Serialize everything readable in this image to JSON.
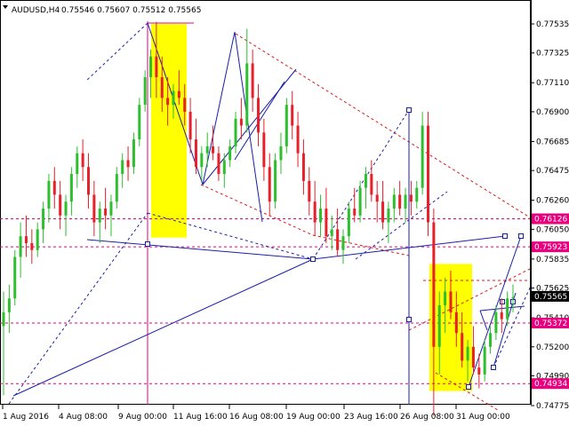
{
  "header": {
    "symbol": "AUDUSD,H4",
    "ohlc": "0.75546 0.75607 0.75512 0.75565"
  },
  "colors": {
    "bull": "#2dbf2d",
    "bear": "#e8202a",
    "level": "#e6007e",
    "trend": "#1b1fa8",
    "channel": "#e01818",
    "highlight": "#ffff00",
    "last_price_bg": "#000000"
  },
  "chart_data": {
    "type": "candlestick",
    "ylim": [
      0.7469,
      0.7779
    ],
    "y_ticks": [
      0.77535,
      0.77325,
      0.7711,
      0.769,
      0.76685,
      0.76475,
      0.7626,
      0.7605,
      0.75835,
      0.75625,
      0.7541,
      0.752,
      0.7499,
      0.74775
    ],
    "y_tick_labels": [
      "0.77535",
      "0.77325",
      "0.77110",
      "0.76900",
      "0.76685",
      "0.76475",
      "0.76260",
      "0.76050",
      "0.75835",
      "0.75625",
      "0.75410",
      "0.75200",
      "0.74990",
      "0.74775"
    ],
    "x_ticks": [
      "1 Aug 2016",
      "4 Aug 08:00",
      "9 Aug 00:00",
      "11 Aug 16:00",
      "16 Aug 08:00",
      "19 Aug 00:00",
      "23 Aug 16:00",
      "26 Aug 08:00",
      "31 Aug 00:00"
    ],
    "levels": [
      {
        "value": 0.76126,
        "label": "0.76126"
      },
      {
        "value": 0.75923,
        "label": "0.75923"
      },
      {
        "value": 0.75372,
        "label": "0.75372"
      },
      {
        "value": 0.74934,
        "label": "0.74934"
      }
    ],
    "last_price": {
      "value": 0.75565,
      "label": "0.75565"
    },
    "candle_count": 116,
    "ohlc_approx": [
      [
        0.7535,
        0.756,
        0.7485,
        0.7545
      ],
      [
        0.7545,
        0.7565,
        0.753,
        0.7555
      ],
      [
        0.7555,
        0.759,
        0.755,
        0.7585
      ],
      [
        0.7585,
        0.761,
        0.757,
        0.76
      ],
      [
        0.76,
        0.7615,
        0.7585,
        0.7595
      ],
      [
        0.7595,
        0.7605,
        0.758,
        0.759
      ],
      [
        0.759,
        0.761,
        0.7585,
        0.7605
      ],
      [
        0.7605,
        0.7625,
        0.7595,
        0.762
      ],
      [
        0.762,
        0.7645,
        0.761,
        0.764
      ],
      [
        0.764,
        0.765,
        0.762,
        0.763
      ],
      [
        0.763,
        0.764,
        0.7605,
        0.7615
      ],
      [
        0.7615,
        0.763,
        0.76,
        0.7625
      ],
      [
        0.7625,
        0.765,
        0.7615,
        0.7645
      ],
      [
        0.7645,
        0.7665,
        0.7635,
        0.766
      ],
      [
        0.766,
        0.767,
        0.764,
        0.765
      ],
      [
        0.765,
        0.766,
        0.762,
        0.763
      ],
      [
        0.763,
        0.764,
        0.76,
        0.761
      ],
      [
        0.761,
        0.7625,
        0.7595,
        0.762
      ],
      [
        0.762,
        0.7635,
        0.7605,
        0.7615
      ],
      [
        0.7615,
        0.763,
        0.76,
        0.7625
      ],
      [
        0.7625,
        0.765,
        0.762,
        0.7645
      ],
      [
        0.7645,
        0.766,
        0.7635,
        0.7655
      ],
      [
        0.7655,
        0.7665,
        0.764,
        0.765
      ],
      [
        0.765,
        0.7675,
        0.7645,
        0.767
      ],
      [
        0.767,
        0.77,
        0.7665,
        0.7695
      ],
      [
        0.7695,
        0.772,
        0.769,
        0.7715
      ],
      [
        0.7715,
        0.7735,
        0.77,
        0.773
      ],
      [
        0.773,
        0.7755,
        0.77,
        0.7715
      ],
      [
        0.7715,
        0.773,
        0.769,
        0.77
      ],
      [
        0.77,
        0.7715,
        0.768,
        0.7695
      ],
      [
        0.7695,
        0.771,
        0.7685,
        0.7705
      ],
      [
        0.7705,
        0.772,
        0.7695,
        0.77
      ],
      [
        0.77,
        0.771,
        0.768,
        0.769
      ],
      [
        0.769,
        0.77,
        0.766,
        0.767
      ],
      [
        0.767,
        0.7685,
        0.7645,
        0.765
      ],
      [
        0.765,
        0.7665,
        0.764,
        0.766
      ],
      [
        0.766,
        0.7675,
        0.765,
        0.7665
      ],
      [
        0.7665,
        0.768,
        0.7655,
        0.766
      ],
      [
        0.766,
        0.7665,
        0.764,
        0.7645
      ],
      [
        0.7645,
        0.766,
        0.7635,
        0.7655
      ],
      [
        0.7655,
        0.767,
        0.765,
        0.7665
      ],
      [
        0.7665,
        0.769,
        0.766,
        0.7685
      ],
      [
        0.7685,
        0.77,
        0.767,
        0.768
      ],
      [
        0.768,
        0.775,
        0.7675,
        0.7725
      ],
      [
        0.7725,
        0.7735,
        0.769,
        0.77
      ],
      [
        0.77,
        0.771,
        0.7665,
        0.7675
      ],
      [
        0.7675,
        0.7685,
        0.764,
        0.765
      ],
      [
        0.765,
        0.766,
        0.7615,
        0.7625
      ],
      [
        0.7625,
        0.766,
        0.762,
        0.7655
      ],
      [
        0.7655,
        0.7675,
        0.7645,
        0.7665
      ],
      [
        0.7665,
        0.77,
        0.766,
        0.7695
      ],
      [
        0.7695,
        0.7705,
        0.767,
        0.768
      ],
      [
        0.768,
        0.769,
        0.765,
        0.766
      ],
      [
        0.766,
        0.767,
        0.763,
        0.764
      ],
      [
        0.764,
        0.765,
        0.7615,
        0.7625
      ],
      [
        0.7625,
        0.764,
        0.76,
        0.761
      ],
      [
        0.761,
        0.763,
        0.76,
        0.762
      ],
      [
        0.762,
        0.7635,
        0.7595,
        0.76
      ],
      [
        0.76,
        0.7615,
        0.759,
        0.7605
      ],
      [
        0.7605,
        0.762,
        0.7585,
        0.759
      ],
      [
        0.759,
        0.7605,
        0.758,
        0.76
      ],
      [
        0.76,
        0.7625,
        0.7595,
        0.762
      ],
      [
        0.762,
        0.7635,
        0.761,
        0.7615
      ],
      [
        0.7615,
        0.764,
        0.761,
        0.7635
      ],
      [
        0.7635,
        0.765,
        0.762,
        0.7645
      ],
      [
        0.7645,
        0.7655,
        0.7625,
        0.763
      ],
      [
        0.763,
        0.764,
        0.761,
        0.7625
      ],
      [
        0.7625,
        0.764,
        0.7605,
        0.761
      ],
      [
        0.761,
        0.7625,
        0.7595,
        0.762
      ],
      [
        0.762,
        0.7635,
        0.761,
        0.763
      ],
      [
        0.763,
        0.764,
        0.7615,
        0.762
      ],
      [
        0.762,
        0.7635,
        0.761,
        0.763
      ],
      [
        0.763,
        0.764,
        0.7615,
        0.7625
      ],
      [
        0.7625,
        0.764,
        0.762,
        0.7635
      ],
      [
        0.7635,
        0.769,
        0.763,
        0.768
      ],
      [
        0.768,
        0.769,
        0.76,
        0.761
      ],
      [
        0.761,
        0.762,
        0.747,
        0.752
      ],
      [
        0.752,
        0.756,
        0.75,
        0.755
      ],
      [
        0.755,
        0.757,
        0.753,
        0.756
      ],
      [
        0.756,
        0.7575,
        0.754,
        0.7545
      ],
      [
        0.7545,
        0.756,
        0.752,
        0.753
      ],
      [
        0.753,
        0.7545,
        0.7505,
        0.751
      ],
      [
        0.751,
        0.7525,
        0.7495,
        0.752
      ],
      [
        0.752,
        0.7535,
        0.75,
        0.7505
      ],
      [
        0.7505,
        0.7515,
        0.749,
        0.75
      ],
      [
        0.75,
        0.7525,
        0.7495,
        0.752
      ],
      [
        0.752,
        0.7535,
        0.7515,
        0.753
      ],
      [
        0.753,
        0.755,
        0.7525,
        0.7545
      ],
      [
        0.7545,
        0.7555,
        0.753,
        0.754
      ],
      [
        0.754,
        0.756,
        0.7535,
        0.7555
      ],
      [
        0.7555,
        0.7565,
        0.7545,
        0.7556
      ]
    ]
  }
}
